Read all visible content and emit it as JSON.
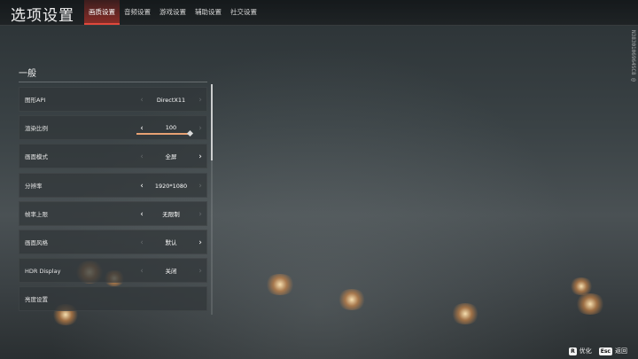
{
  "header": {
    "title": "选项设置",
    "tabs": [
      {
        "label": "画质设置",
        "active": true
      },
      {
        "label": "音频设置",
        "active": false
      },
      {
        "label": "游戏设置",
        "active": false
      },
      {
        "label": "辅助设置",
        "active": false
      },
      {
        "label": "社交设置",
        "active": false
      }
    ]
  },
  "side_code": "N3830106964SC8 @",
  "section": {
    "title": "一般",
    "scroll_position": 0.0,
    "rows": [
      {
        "label": "图形API",
        "value": "DirectX11",
        "left_enabled": false,
        "right_enabled": false
      },
      {
        "label": "渲染比例",
        "value": "100",
        "left_enabled": true,
        "right_enabled": false,
        "slider_fraction": 1.0
      },
      {
        "label": "画面模式",
        "value": "全屏",
        "left_enabled": false,
        "right_enabled": true
      },
      {
        "label": "分辨率",
        "value": "1920*1080",
        "left_enabled": true,
        "right_enabled": false
      },
      {
        "label": "帧率上限",
        "value": "无限制",
        "left_enabled": true,
        "right_enabled": false
      },
      {
        "label": "画面风格",
        "value": "默认",
        "left_enabled": false,
        "right_enabled": true
      },
      {
        "label": "HDR Display",
        "value": "关闭",
        "left_enabled": false,
        "right_enabled": false
      },
      {
        "label": "亮度设置",
        "value": "",
        "left_enabled": false,
        "right_enabled": false
      }
    ]
  },
  "footer": {
    "hints": [
      {
        "key": "R",
        "label": "优化"
      },
      {
        "key": "Esc",
        "label": "返回"
      }
    ]
  },
  "colors": {
    "accent": "#e0483c",
    "slider_fill": "#e7a173"
  },
  "icons": {
    "left_arrow": "chevron-left-icon",
    "right_arrow": "chevron-right-icon"
  }
}
